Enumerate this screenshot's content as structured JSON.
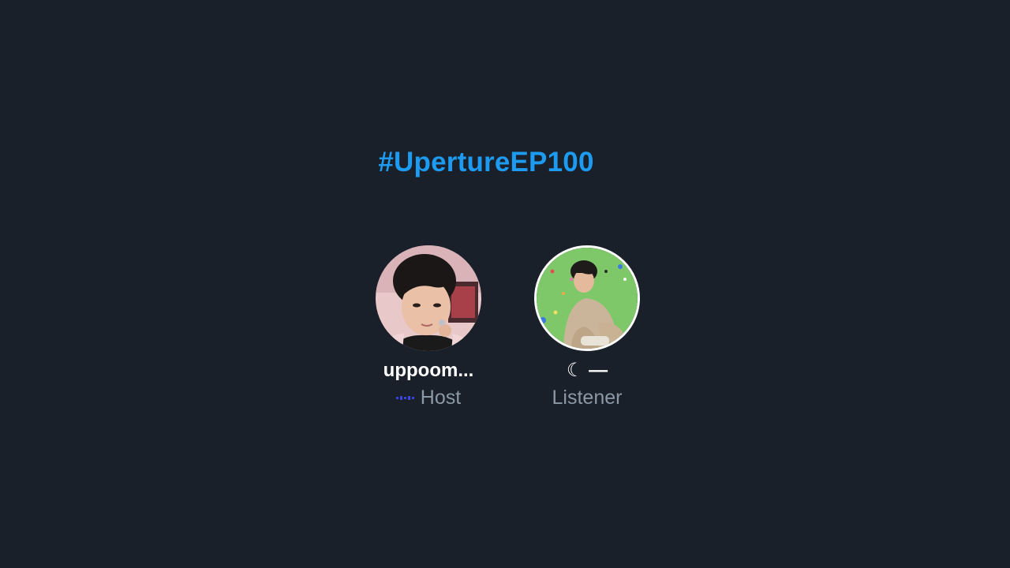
{
  "space": {
    "hashtag": "#UpertureEP100"
  },
  "participants": [
    {
      "name": "uppoom...",
      "role": "Host",
      "speaking": true,
      "avatar_icon": "avatar-photo-icon"
    },
    {
      "name": "☾ —",
      "role": "Listener",
      "speaking": false,
      "avatar_icon": "avatar-photo-icon"
    }
  ],
  "colors": {
    "background": "#1a202a",
    "hashtag": "#1d9bf0",
    "name": "#ffffff",
    "role": "#8b98a5",
    "speaking": "#3b46f0"
  }
}
